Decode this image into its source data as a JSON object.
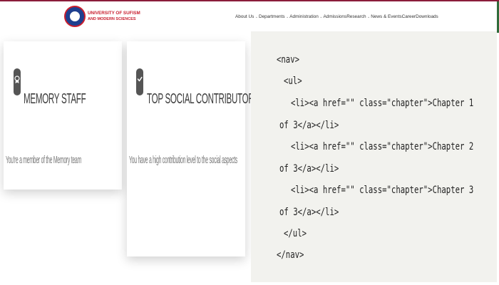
{
  "header": {
    "logo_line1": "UNIVERSITY OF SUFISM",
    "logo_line2": "AND MODERN SCIENCES",
    "nav": [
      {
        "label": "About Us",
        "caret": true
      },
      {
        "label": "Departments",
        "caret": true
      },
      {
        "label": "Administration",
        "caret": true
      },
      {
        "label": "Admissions",
        "caret": false
      },
      {
        "label": "Research",
        "caret": true
      },
      {
        "label": "News & Events",
        "caret": false
      },
      {
        "label": "Career",
        "caret": false
      },
      {
        "label": "Downloads",
        "caret": false
      }
    ]
  },
  "cards": [
    {
      "icon": "award-badge-icon",
      "title": "MEMORY STAFF",
      "description": "You're a member of the Memory team"
    },
    {
      "icon": "check-badge-icon",
      "title": "TOP SOCIAL CONTRIBUTOR",
      "description": "You have a high contribution level to the social aspects"
    }
  ],
  "code": {
    "lines": [
      "<nav>",
      "  <ul>",
      "    <li><a href=\"\" class=\"chapter\">Chapter 1",
      "  of 3</a></li>",
      "    <li><a href=\"\" class=\"chapter\">Chapter 2",
      "  of 3</a></li>",
      "    <li><a href=\"\" class=\"chapter\">Chapter 3",
      "  of 3</a></li>",
      "   </ul>",
      "  </nav>"
    ]
  },
  "colors": {
    "brand_red": "#c81e2e",
    "brand_blue": "#1e3f8f",
    "code_bg": "#f2f2ee"
  }
}
